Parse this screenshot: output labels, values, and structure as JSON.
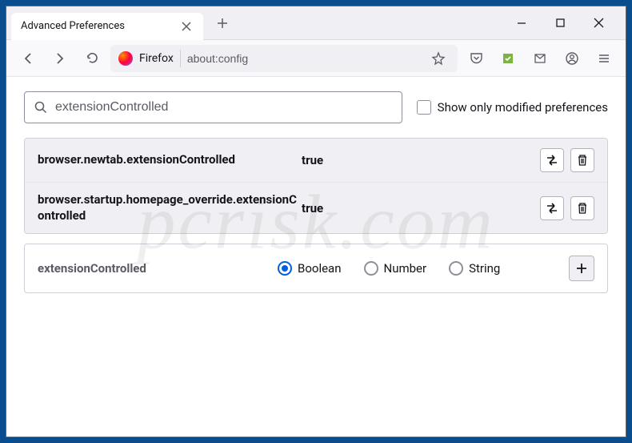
{
  "window": {
    "tab_title": "Advanced Preferences"
  },
  "urlbar": {
    "identity": "Firefox",
    "url": "about:config"
  },
  "search": {
    "value": "extensionControlled",
    "modified_only_label": "Show only modified preferences"
  },
  "prefs": [
    {
      "name": "browser.newtab.extensionControlled",
      "value": "true"
    },
    {
      "name": "browser.startup.homepage_override.extensionControlled",
      "value": "true"
    }
  ],
  "new_pref": {
    "name": "extensionControlled",
    "types": [
      "Boolean",
      "Number",
      "String"
    ],
    "selected": "Boolean"
  },
  "watermark": "pcrisk.com"
}
